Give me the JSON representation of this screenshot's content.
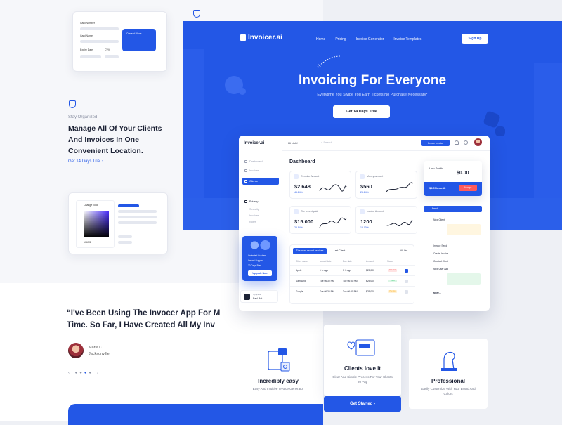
{
  "left": {
    "card_form": {
      "card_number": "Card Number",
      "card_name": "Card Name",
      "expiry": "Expiry Date",
      "cvv": "CVV",
      "card_brand": "Current Blnce"
    },
    "stay_label": "Stay Organized",
    "headline": "Manage All Of Your Clients And Invoices In One Convenient Location.",
    "trial_link": "Get 14 Days Trial",
    "color_label": "Change color",
    "hex_value": "#063f1",
    "testimonial": "“I've Been Using The Invocer App For M… Time. So Far, I Have Created All My Inv…",
    "testimonial_l1": "“I've Been Using The Invocer App For M",
    "testimonial_l2": "Time. So Far, I Have Created All My Inv",
    "reviewer_name": "Maria C.",
    "reviewer_city": "Jacksonville"
  },
  "hero": {
    "logo": "Invoicer.ai",
    "nav": [
      "Home",
      "Pricing",
      "Invoice Generator",
      "Invoice Templates"
    ],
    "signup": "Sign Up",
    "title": "Invoicing For Everyone",
    "subtitle": "Everytime You Swipe You Earn Tickets.No Purchase Necessary*",
    "cta": "Get 14 Days Trial"
  },
  "dashboard": {
    "logo": "Invoicer.ai",
    "greeting": "Hi Linh!",
    "search": "Search",
    "create": "Create Invoice",
    "title": "Dashboard",
    "sidebar": [
      "Dashboard",
      "Invoices",
      "Clients",
      "Privacy",
      "Security",
      "Invoices",
      "Notes"
    ],
    "stats": [
      {
        "label": "Overdue Amount",
        "value": "$2.648",
        "pct": "45.84%"
      },
      {
        "label": "Money amount",
        "value": "$560",
        "pct": "25.84%"
      },
      {
        "label": "The recent paid",
        "value": "$15.000",
        "pct": "25.84%"
      },
      {
        "label": "Invoice Amount",
        "value": "1200",
        "pct": "15.00%"
      }
    ],
    "profile": {
      "name": "Linh Smith",
      "amount": "$0.00",
      "rate": "$4.99/month",
      "accept": "Accept"
    },
    "feed": {
      "title": "Feed",
      "items": [
        "New Client",
        "Invoice Send",
        "Create Invoice",
        "Created Client",
        "New User Add",
        "More..."
      ]
    },
    "table": {
      "tab_active": "The most recent invoices",
      "tab2": "Last Client",
      "all": "All List",
      "headers": [
        "Client name",
        "Issued date",
        "Due date",
        "Amount",
        "Status"
      ],
      "rows": [
        {
          "name": "Apple",
          "issued": "1 h. Ago",
          "due": "1 h. Ago",
          "amount": "$25,000",
          "status": "Not Paid"
        },
        {
          "name": "Samsung",
          "issued": "Tue 06:30 PM",
          "due": "Tue 06:30 PM",
          "amount": "$25,000",
          "status": "Paid"
        },
        {
          "name": "Google",
          "issued": "Tue 06:30 PM",
          "due": "Tue 06:30 PM",
          "amount": "$25,000",
          "status": "Pending"
        }
      ]
    },
    "upgrade": {
      "items": [
        "Unlimited Custom",
        "Instant Support",
        "30 Days Free"
      ],
      "button": "Upgrade Now"
    },
    "user": {
      "name": "Paul Bot",
      "role": "Upgrade"
    }
  },
  "features": [
    {
      "title": "Incredibly easy",
      "desc": "Easy And Intuitive Invoice Generator"
    },
    {
      "title": "Clients love it",
      "desc": "Clear And Simple Process For Your Clients To Pay"
    },
    {
      "title": "Professional",
      "desc": "Easily Customize With Your Brand And Colors"
    }
  ],
  "get_started": "Get Started",
  "colors": {
    "brand": "#2357e6",
    "paid": "#2ac36c",
    "not_paid": "#ff5b5b",
    "pending": "#ffb020"
  }
}
